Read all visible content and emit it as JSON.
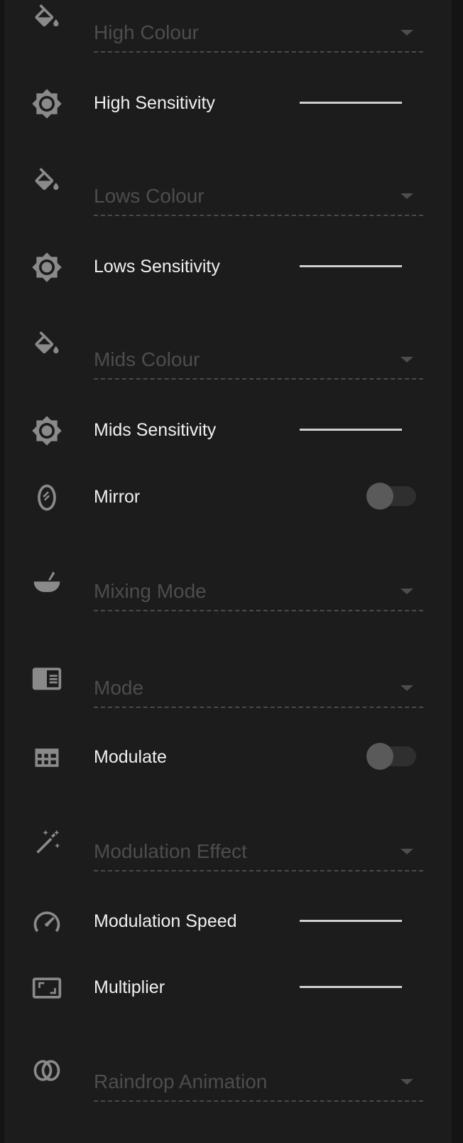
{
  "settings": {
    "high_colour": {
      "label": "High Colour",
      "icon": "paint-bucket-icon",
      "type": "select"
    },
    "high_sensitivity": {
      "label": "High Sensitivity",
      "icon": "brightness-icon",
      "type": "slider"
    },
    "lows_colour": {
      "label": "Lows Colour",
      "icon": "paint-bucket-icon",
      "type": "select"
    },
    "lows_sensitivity": {
      "label": "Lows Sensitivity",
      "icon": "brightness-icon",
      "type": "slider"
    },
    "mids_colour": {
      "label": "Mids Colour",
      "icon": "paint-bucket-icon",
      "type": "select"
    },
    "mids_sensitivity": {
      "label": "Mids Sensitivity",
      "icon": "brightness-icon",
      "type": "slider"
    },
    "mirror": {
      "label": "Mirror",
      "icon": "mirror-icon",
      "type": "toggle",
      "on": false
    },
    "mixing_mode": {
      "label": "Mixing Mode",
      "icon": "mortar-bowl-icon",
      "type": "select"
    },
    "mode": {
      "label": "Mode",
      "icon": "view-list-icon",
      "type": "select"
    },
    "modulate": {
      "label": "Modulate",
      "icon": "grid-icon",
      "type": "toggle",
      "on": false
    },
    "modulation_effect": {
      "label": "Modulation Effect",
      "icon": "magic-wand-icon",
      "type": "select"
    },
    "modulation_speed": {
      "label": "Modulation Speed",
      "icon": "speedometer-icon",
      "type": "slider"
    },
    "multiplier": {
      "label": "Multiplier",
      "icon": "aspect-ratio-icon",
      "type": "slider"
    },
    "raindrop_animation": {
      "label": "Raindrop Animation",
      "icon": "rings-icon",
      "type": "select"
    }
  },
  "colors": {
    "panel_bg": "#1c1c1c",
    "label_text": "#f0f0f0",
    "disabled_text": "#4d4d4d",
    "icon": "#8a8a8a",
    "slider": "#cfcfcf"
  }
}
